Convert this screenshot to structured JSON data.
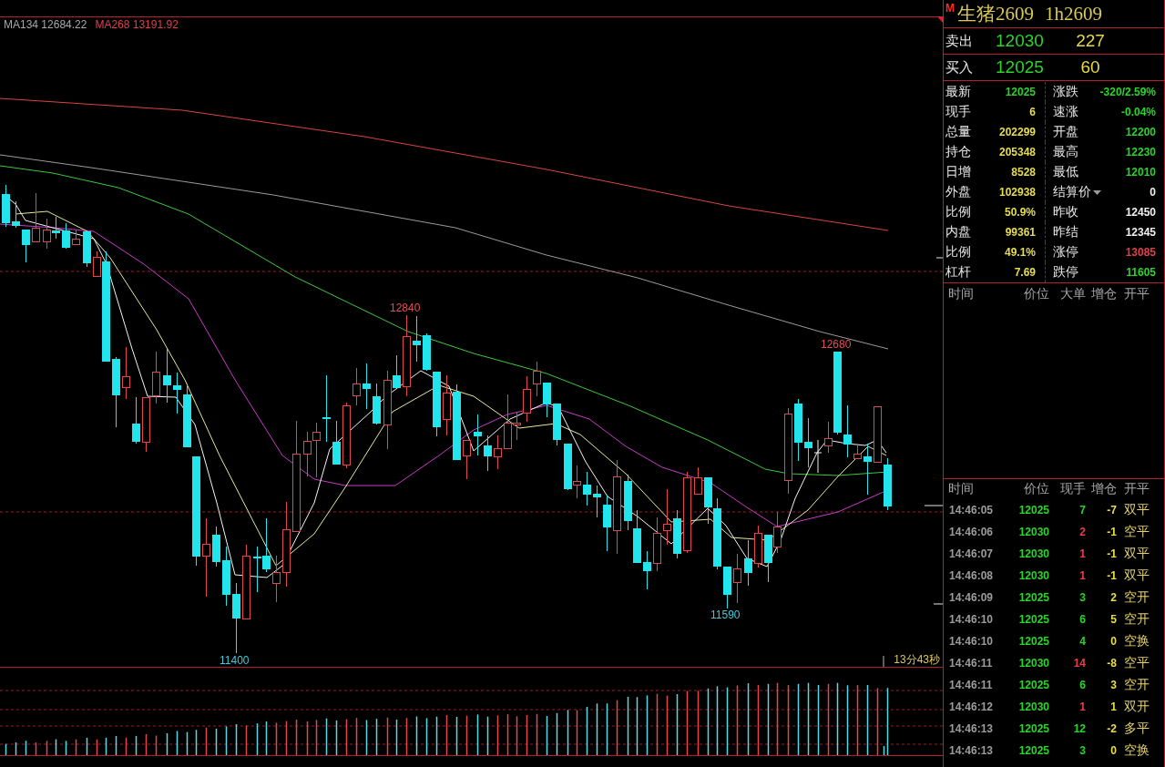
{
  "chart": {
    "legend": [
      {
        "text": "MA134 12684.22",
        "color": "#a8a8a8"
      },
      {
        "text": "MA268 13191.92",
        "color": "#e0404c"
      }
    ],
    "markers": [
      {
        "kind": "high",
        "text": "12840"
      },
      {
        "kind": "low",
        "text": "11400"
      },
      {
        "kind": "high",
        "text": "12680"
      },
      {
        "kind": "low",
        "text": "11590"
      }
    ],
    "countdown": "13分43秒"
  },
  "quote": {
    "badge": "M",
    "name": "生猪2609",
    "code": "1h2609",
    "ask": {
      "label": "卖出",
      "price": "12030",
      "volume": "227"
    },
    "bid": {
      "label": "买入",
      "price": "12025",
      "volume": "60"
    },
    "stats": [
      {
        "kind": "value",
        "label": "最新",
        "value": "12025",
        "color": "#2ad42a"
      },
      {
        "kind": "value",
        "label": "涨跌",
        "value": "-320/2.59%",
        "color": "#2ad42a"
      },
      {
        "kind": "value",
        "label": "现手",
        "value": "6",
        "color": "#e6dc50"
      },
      {
        "kind": "value",
        "label": "速涨",
        "value": "-0.04%",
        "color": "#2ad42a"
      },
      {
        "kind": "value",
        "label": "总量",
        "value": "202299",
        "color": "#e6dc50"
      },
      {
        "kind": "value",
        "label": "开盘",
        "value": "12200",
        "color": "#2ad42a"
      },
      {
        "kind": "value",
        "label": "持仓",
        "value": "205348",
        "color": "#e6dc50"
      },
      {
        "kind": "value",
        "label": "最高",
        "value": "12230",
        "color": "#2ad42a"
      },
      {
        "kind": "value",
        "label": "日增",
        "value": "8528",
        "color": "#e6dc50"
      },
      {
        "kind": "value",
        "label": "最低",
        "value": "12010",
        "color": "#2ad42a"
      },
      {
        "kind": "value",
        "label": "外盘",
        "value": "102938",
        "color": "#e6dc50"
      },
      {
        "kind": "dropdown",
        "label": "结算价",
        "value": "0",
        "color": "#f0f0f0"
      },
      {
        "kind": "value",
        "label": "比例",
        "value": "50.9%",
        "color": "#e6dc50"
      },
      {
        "kind": "value",
        "label": "昨收",
        "value": "12450",
        "color": "#f0f0f0"
      },
      {
        "kind": "value",
        "label": "内盘",
        "value": "99361",
        "color": "#e6dc50"
      },
      {
        "kind": "value",
        "label": "昨结",
        "value": "12345",
        "color": "#f0f0f0"
      },
      {
        "kind": "value",
        "label": "比例",
        "value": "49.1%",
        "color": "#e6dc50"
      },
      {
        "kind": "value",
        "label": "涨停",
        "value": "13085",
        "color": "#e0404a"
      },
      {
        "kind": "value",
        "label": "杠杆",
        "value": "7.69",
        "color": "#e6dc50"
      },
      {
        "kind": "value",
        "label": "跌停",
        "value": "11605",
        "color": "#2ad42a"
      }
    ]
  },
  "big_orders": {
    "columns": [
      "时间",
      "价位",
      "大单",
      "增仓",
      "开平"
    ]
  },
  "ticks": {
    "columns": [
      "时间",
      "价位",
      "现手",
      "增仓",
      "开平"
    ],
    "rows": [
      {
        "time": "14:46:05",
        "price": "12025",
        "hand": "7",
        "color": "#2ad42a",
        "change": "-7",
        "type": "双平"
      },
      {
        "time": "14:46:06",
        "price": "12030",
        "hand": "2",
        "color": "#e0404a",
        "change": "-1",
        "type": "空平"
      },
      {
        "time": "14:46:07",
        "price": "12030",
        "hand": "1",
        "color": "#e0404a",
        "change": "-1",
        "type": "双平"
      },
      {
        "time": "14:46:08",
        "price": "12030",
        "hand": "1",
        "color": "#e0404a",
        "change": "-1",
        "type": "双平"
      },
      {
        "time": "14:46:09",
        "price": "12025",
        "hand": "3",
        "color": "#2ad42a",
        "change": "2",
        "type": "空开"
      },
      {
        "time": "14:46:10",
        "price": "12025",
        "hand": "6",
        "color": "#2ad42a",
        "change": "5",
        "type": "空开"
      },
      {
        "time": "14:46:10",
        "price": "12025",
        "hand": "4",
        "color": "#2ad42a",
        "change": "0",
        "type": "空换"
      },
      {
        "time": "14:46:11",
        "price": "12030",
        "hand": "14",
        "color": "#e0404a",
        "change": "-8",
        "type": "空平"
      },
      {
        "time": "14:46:11",
        "price": "12025",
        "hand": "6",
        "color": "#2ad42a",
        "change": "3",
        "type": "空开"
      },
      {
        "time": "14:46:12",
        "price": "12030",
        "hand": "1",
        "color": "#e0404a",
        "change": "1",
        "type": "双开"
      },
      {
        "time": "14:46:13",
        "price": "12025",
        "hand": "12",
        "color": "#2ad42a",
        "change": "-2",
        "type": "多平"
      },
      {
        "time": "14:46:13",
        "price": "12025",
        "hand": "3",
        "color": "#2ad42a",
        "change": "0",
        "type": "空换"
      }
    ]
  }
}
